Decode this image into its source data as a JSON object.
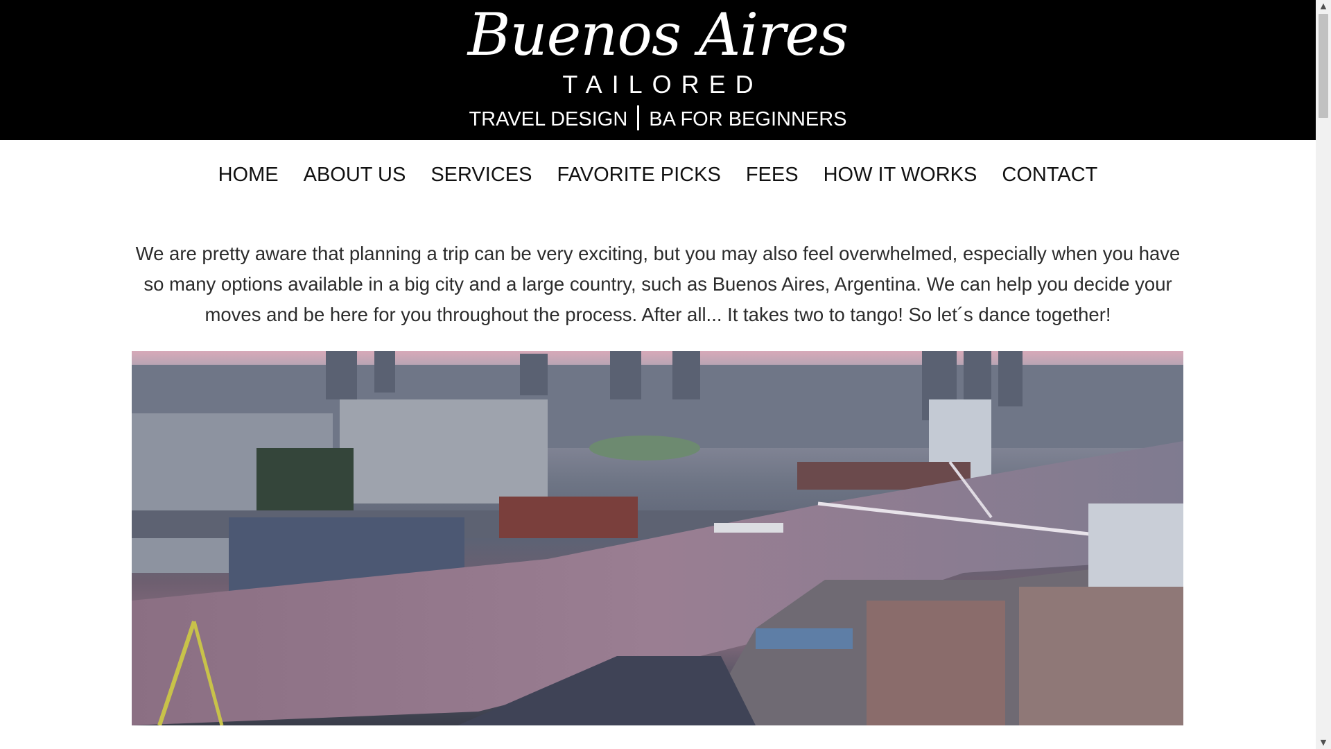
{
  "header": {
    "logo_script": "Buenos Aires",
    "logo_sub": "TAILORED",
    "tagline_left": "TRAVEL DESIGN",
    "tagline_right": "BA FOR BEGINNERS"
  },
  "nav": {
    "items": [
      {
        "label": "HOME"
      },
      {
        "label": "ABOUT US"
      },
      {
        "label": "SERVICES"
      },
      {
        "label": "FAVORITE PICKS"
      },
      {
        "label": "FEES"
      },
      {
        "label": "HOW IT WORKS"
      },
      {
        "label": "CONTACT"
      }
    ]
  },
  "main": {
    "intro": "We are pretty aware that planning a trip can be very exciting, but you may also feel overwhelmed, especially when you have so many options available in a big city and a large country, such as Buenos Aires, Argentina. We can help you decide your moves and be here for you throughout the process. After all... It takes two to tango! So let´s dance together!"
  },
  "colors": {
    "header_bg": "#000000",
    "header_text": "#ffffff",
    "nav_text": "#111111",
    "body_text": "#2b2b2b"
  },
  "icons": {
    "scroll_up": "chevron-up-icon",
    "scroll_down": "chevron-down-icon"
  }
}
